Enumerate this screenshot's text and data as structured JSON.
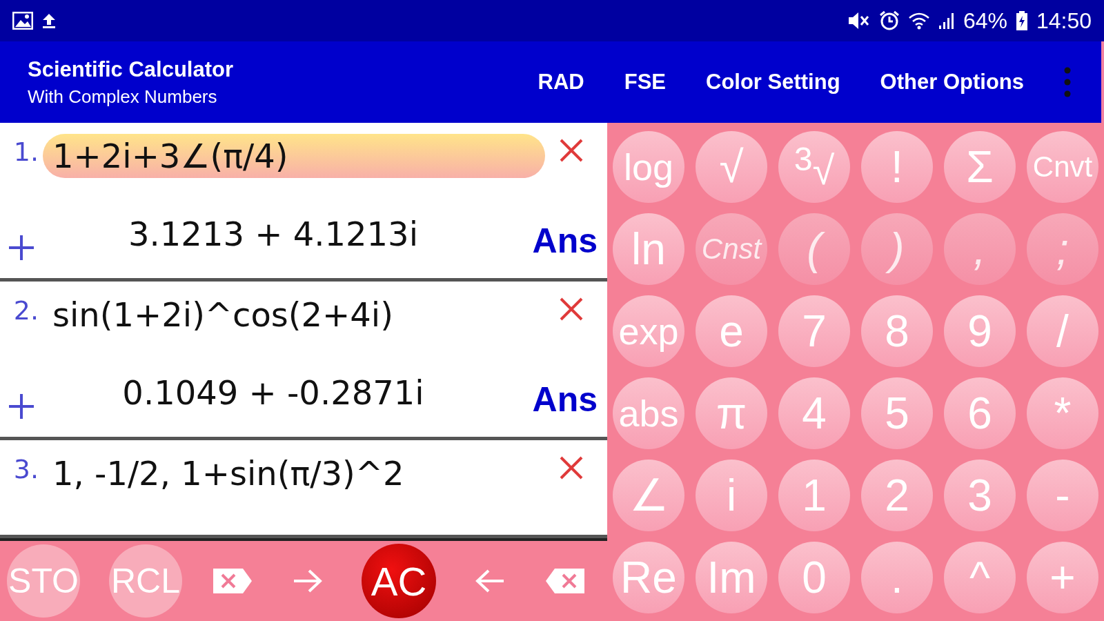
{
  "status_bar": {
    "battery": "64%",
    "time": "14:50"
  },
  "app_bar": {
    "title": "Scientific Calculator",
    "subtitle": "With Complex Numbers",
    "actions": [
      "RAD",
      "FSE",
      "Color Setting",
      "Other Options"
    ]
  },
  "history": [
    {
      "index": "1.",
      "expression": "1+2i+3∠(π/4)",
      "selected": true,
      "result": "3.1213 + 4.1213i",
      "ans": "Ans"
    },
    {
      "index": "2.",
      "expression": "sin(1+2i)^cos(2+4i)",
      "selected": false,
      "result": "0.1049 + -0.2871i",
      "ans": "Ans"
    },
    {
      "index": "3.",
      "expression": "1, -1/2, 1+sin(π/3)^2",
      "selected": false
    }
  ],
  "bottom_keys": [
    {
      "kind": "round",
      "label": "STO"
    },
    {
      "kind": "round",
      "label": "RCL"
    },
    {
      "kind": "delete-right"
    },
    {
      "kind": "arrow-right"
    },
    {
      "kind": "clear",
      "label": "AC"
    },
    {
      "kind": "arrow-left"
    },
    {
      "kind": "backspace"
    }
  ],
  "keypad": [
    {
      "label": "log",
      "disabled": false
    },
    {
      "label": "√",
      "disabled": false
    },
    {
      "label": "$^{3}$√",
      "disabled": false
    },
    {
      "label": "!",
      "disabled": false
    },
    {
      "label": "Σ",
      "disabled": false
    },
    {
      "label": "Cnvt",
      "disabled": false
    },
    {
      "label": "ln",
      "disabled": false
    },
    {
      "label": "Cnst",
      "disabled": true
    },
    {
      "label": "(",
      "disabled": true
    },
    {
      "label": ")",
      "disabled": true
    },
    {
      "label": ",",
      "disabled": true
    },
    {
      "label": ";",
      "disabled": true
    },
    {
      "label": "exp",
      "disabled": false
    },
    {
      "label": "e",
      "disabled": false
    },
    {
      "label": "7",
      "disabled": false
    },
    {
      "label": "8",
      "disabled": false
    },
    {
      "label": "9",
      "disabled": false
    },
    {
      "label": "/",
      "disabled": false
    },
    {
      "label": "abs",
      "disabled": false
    },
    {
      "label": "π",
      "disabled": false
    },
    {
      "label": "4",
      "disabled": false
    },
    {
      "label": "5",
      "disabled": false
    },
    {
      "label": "6",
      "disabled": false
    },
    {
      "label": "*",
      "disabled": false
    },
    {
      "label": "∠",
      "disabled": false
    },
    {
      "label": "i",
      "disabled": false
    },
    {
      "label": "1",
      "disabled": false
    },
    {
      "label": "2",
      "disabled": false
    },
    {
      "label": "3",
      "disabled": false
    },
    {
      "label": "-",
      "disabled": false
    },
    {
      "label": "Re",
      "disabled": false
    },
    {
      "label": "Im",
      "disabled": false
    },
    {
      "label": "0",
      "disabled": false
    },
    {
      "label": ".",
      "disabled": false
    },
    {
      "label": "^",
      "disabled": false
    },
    {
      "label": "+",
      "disabled": false
    }
  ]
}
